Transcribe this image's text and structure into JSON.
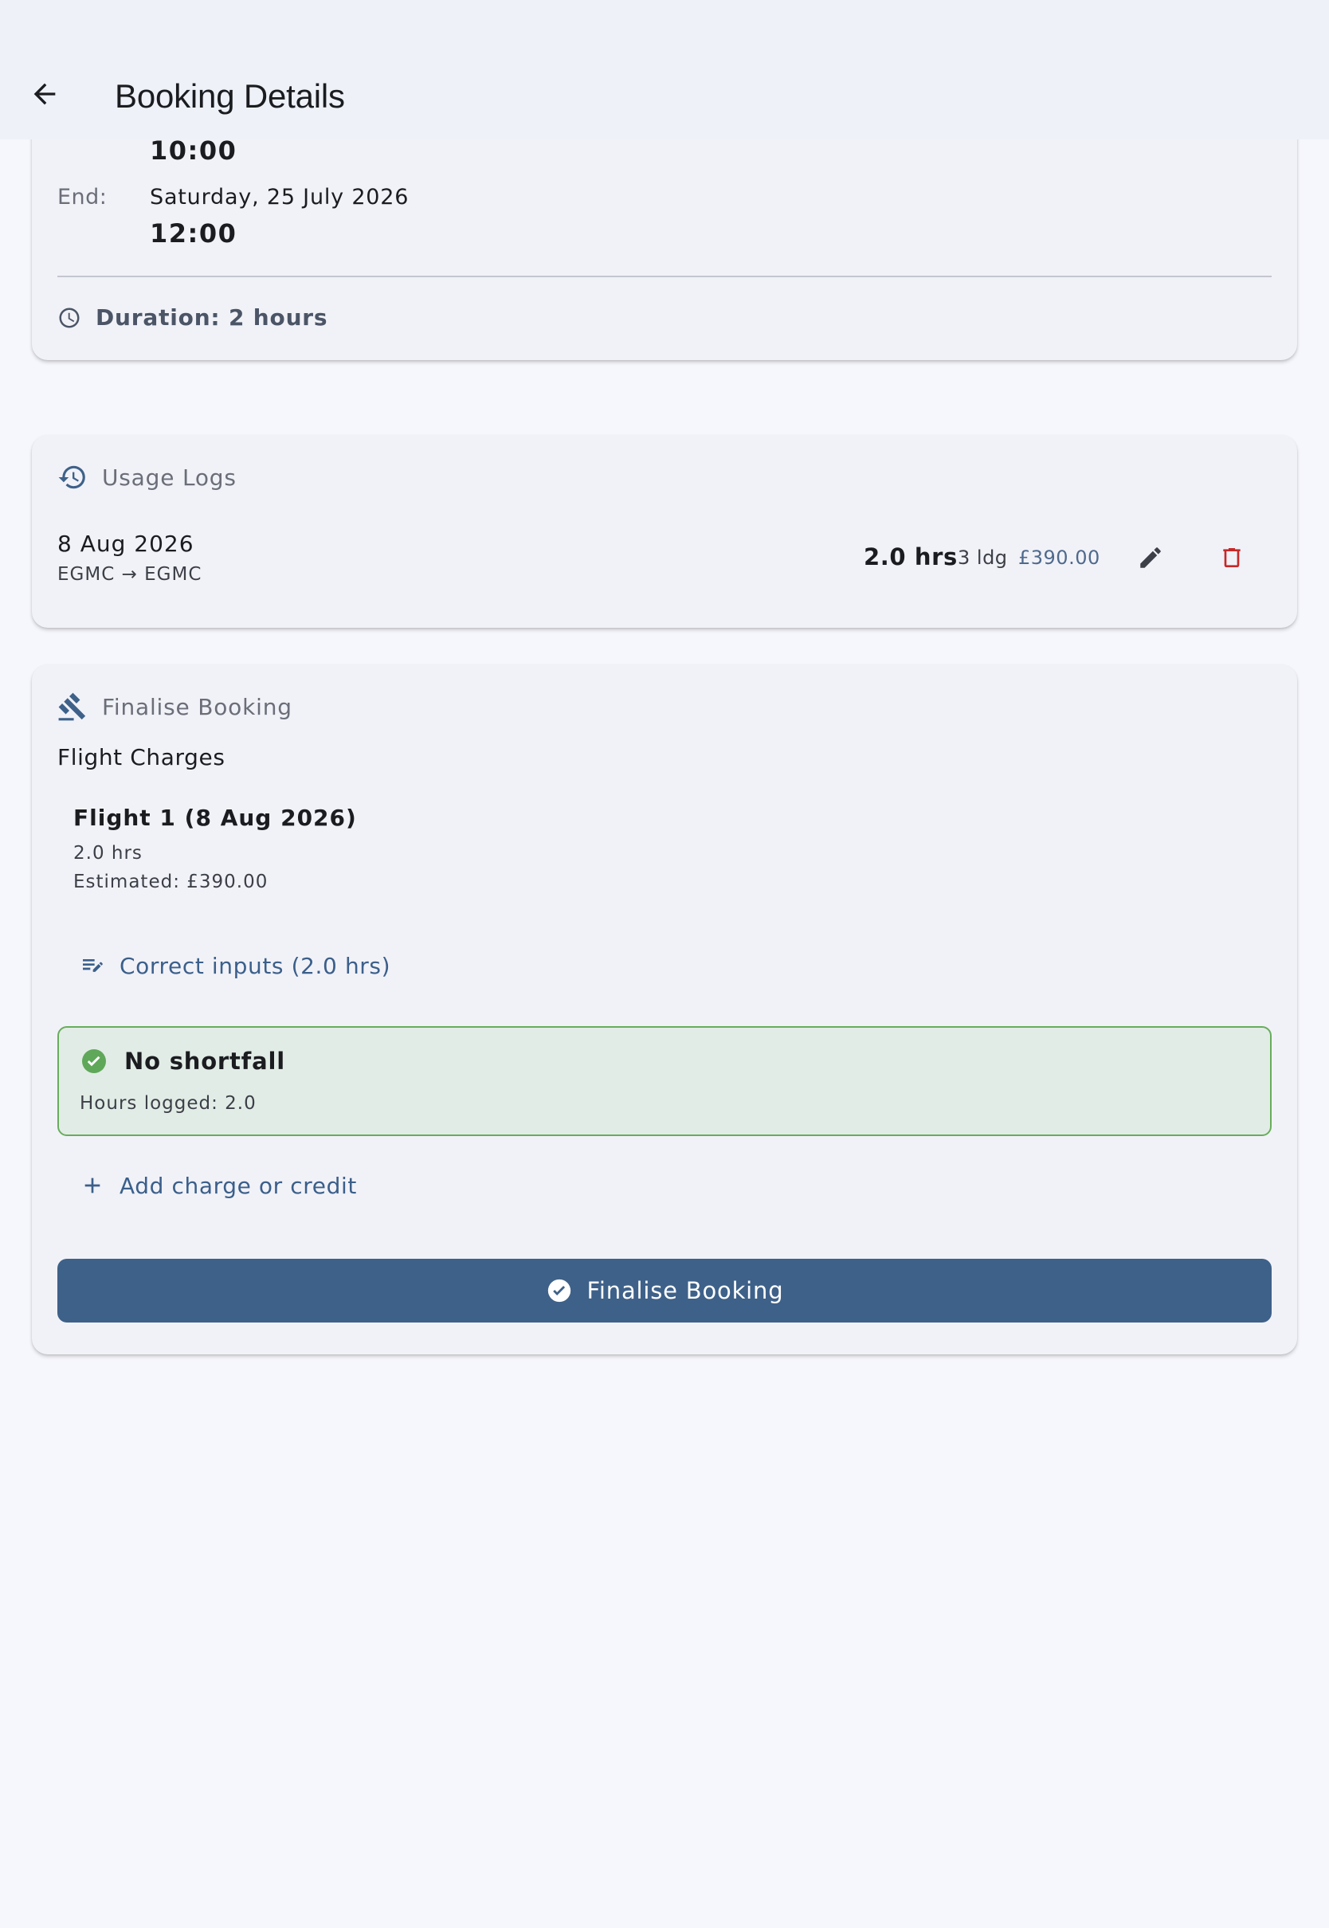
{
  "appbar": {
    "title": "Booking Details"
  },
  "schedule": {
    "start_time": "10:00",
    "end_label": "End:",
    "end_date": "Saturday, 25 July 2026",
    "end_time": "12:00",
    "duration": "Duration: 2 hours"
  },
  "usage_logs": {
    "title": "Usage Logs",
    "entries": [
      {
        "date": "8 Aug 2026",
        "route": "EGMC → EGMC",
        "hours": "2.0 hrs",
        "landings": "3 ldg",
        "price": "£390.00"
      }
    ]
  },
  "finalise": {
    "title": "Finalise Booking",
    "section_label": "Flight Charges",
    "flights": [
      {
        "title": "Flight 1 (8 Aug 2026)",
        "hours": "2.0 hrs",
        "estimate": "Estimated: £390.00"
      }
    ],
    "correct_inputs_label": "Correct inputs (2.0 hrs)",
    "shortfall": {
      "title": "No shortfall",
      "detail": "Hours logged: 2.0"
    },
    "add_charge_label": "Add charge or credit",
    "finalise_button_label": "Finalise Booking"
  },
  "colors": {
    "primary": "#3e6189",
    "accent_text": "#3b5f8a",
    "success": "#67ad5b",
    "danger": "#c62828"
  },
  "icons": {
    "back": "arrow-left-icon",
    "duration": "clock-icon",
    "usage_logs": "history-icon",
    "edit": "pencil-icon",
    "delete": "trash-icon",
    "finalise": "gavel-icon",
    "correct_inputs": "edit-note-icon",
    "shortfall": "check-circle-icon",
    "add": "plus-icon",
    "finalise_button": "check-circle-icon"
  }
}
